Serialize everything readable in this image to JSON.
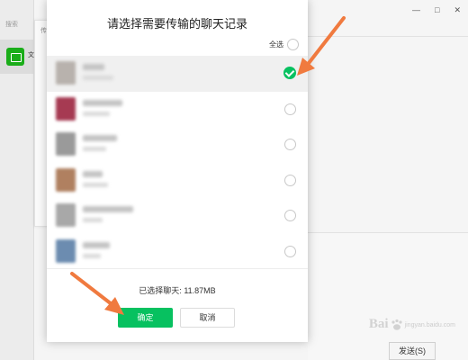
{
  "background": {
    "search_label": "搜索",
    "folder_item_label": "文",
    "midpanel_label": "传",
    "window_controls": [
      "—",
      "□",
      "✕"
    ],
    "send_button": "发送(S)"
  },
  "dialog": {
    "title": "请选择需要传输的聊天记录",
    "select_all_label": "全选",
    "chats": [
      {
        "selected": true,
        "avatar_color": "#b8b2ad",
        "name_width": 24,
        "sub_width": 34
      },
      {
        "selected": false,
        "avatar_color": "#a63a52",
        "name_width": 44,
        "sub_width": 30
      },
      {
        "selected": false,
        "avatar_color": "#9a9a9a",
        "name_width": 38,
        "sub_width": 26
      },
      {
        "selected": false,
        "avatar_color": "#b08060",
        "name_width": 22,
        "sub_width": 28
      },
      {
        "selected": false,
        "avatar_color": "#a8a8a8",
        "name_width": 56,
        "sub_width": 22
      },
      {
        "selected": false,
        "avatar_color": "#6c8cb0",
        "name_width": 30,
        "sub_width": 20
      }
    ],
    "status_prefix": "已选择聊天:",
    "status_value": "11.87MB",
    "ok_button": "确定",
    "cancel_button": "取消"
  },
  "colors": {
    "accent_green": "#07c160",
    "arrow_orange": "#f07a3f"
  },
  "watermark": {
    "text": "Bai",
    "sub": "jingyan.baidu.com"
  }
}
